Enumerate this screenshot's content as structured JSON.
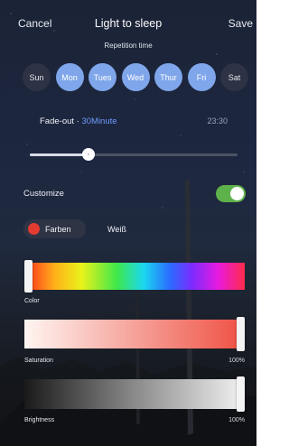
{
  "header": {
    "cancel": "Cancel",
    "title": "Light to sleep",
    "save": "Save"
  },
  "repetition": {
    "label": "Repetition time",
    "days": [
      {
        "label": "Sun",
        "selected": false
      },
      {
        "label": "Mon",
        "selected": true
      },
      {
        "label": "Tues",
        "selected": true
      },
      {
        "label": "Wed",
        "selected": true
      },
      {
        "label": "Thur",
        "selected": true
      },
      {
        "label": "Fri",
        "selected": true
      },
      {
        "label": "Sat",
        "selected": false
      }
    ]
  },
  "fade_out": {
    "label": "Fade-out · ",
    "duration": "30Minute",
    "time": "23:30",
    "slider_fraction": 0.27
  },
  "customize": {
    "label": "Customize",
    "enabled": true
  },
  "mode": {
    "colors": "Farben",
    "white": "Weiß",
    "selected": "Farben"
  },
  "color": {
    "label": "Color",
    "position_fraction": 0.0
  },
  "saturation": {
    "label": "Saturation",
    "value": "100%",
    "fraction": 1.0
  },
  "brightness": {
    "label": "Brightness",
    "value": "100%",
    "fraction": 1.0
  },
  "colors": {
    "accent": "#6f9bff",
    "selected_day": "#7fa6ea",
    "toggle_on": "#5eb24b",
    "color_dot": "#e33a32"
  }
}
